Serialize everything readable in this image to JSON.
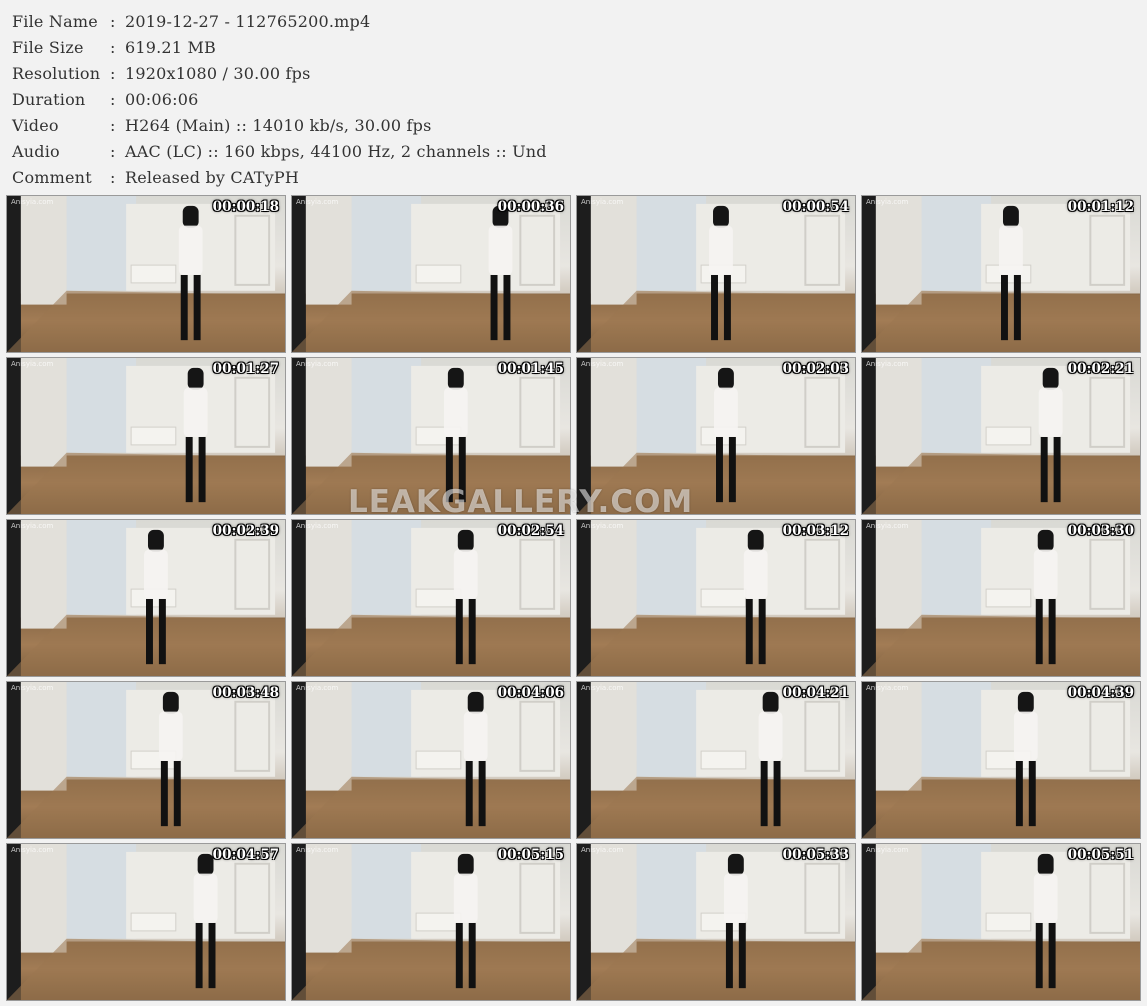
{
  "info": [
    {
      "key": "File Name",
      "value": "2019-12-27 - 112765200.mp4"
    },
    {
      "key": "File Size",
      "value": "619.21 MB"
    },
    {
      "key": "Resolution",
      "value": "1920x1080 / 30.00 fps"
    },
    {
      "key": "Duration",
      "value": "00:06:06"
    },
    {
      "key": "Video",
      "value": "H264 (Main) :: 14010 kb/s, 30.00 fps"
    },
    {
      "key": "Audio",
      "value": "AAC (LC) :: 160 kbps, 44100 Hz, 2 channels :: Und"
    },
    {
      "key": "Comment",
      "value": "Released by CATyPH"
    }
  ],
  "separator": ":",
  "thumbnail_site_label": "Anisyia.com",
  "timestamps": [
    "00:00:18",
    "00:00:36",
    "00:00:54",
    "00:01:12",
    "00:01:27",
    "00:01:45",
    "00:02:03",
    "00:02:21",
    "00:02:39",
    "00:02:54",
    "00:03:12",
    "00:03:30",
    "00:03:48",
    "00:04:06",
    "00:04:21",
    "00:04:39",
    "00:04:57",
    "00:05:15",
    "00:05:33",
    "00:05:51"
  ],
  "watermark": "LEAKGALLERY.COM",
  "colors": {
    "background": "#f2f2f2",
    "text": "#333333",
    "timestamp": "#ffffff"
  }
}
